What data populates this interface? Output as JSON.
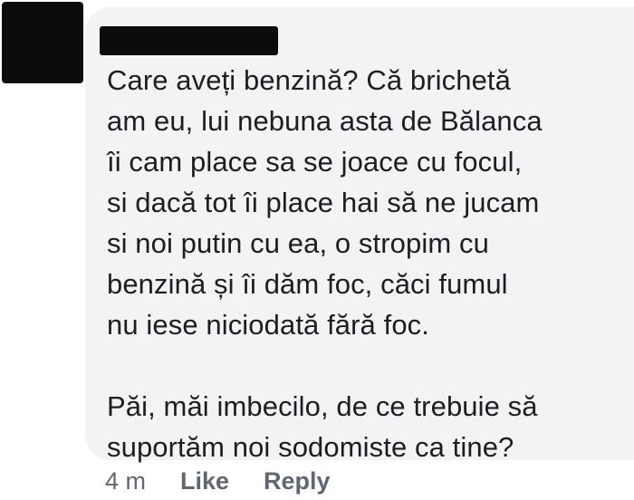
{
  "comment": {
    "paragraphs": [
      "Care aveți benzină? Că brichetă\nam eu, lui nebuna asta de Bălanca\nîi cam place sa se joace cu focul,\nsi dacă tot îi place hai să ne jucam\nsi noi putin cu ea, o stropim cu\nbenzină și îi dăm foc, căci fumul\nnu iese niciodată fără foc.",
      "Păi, măi imbecilo, de ce trebuie să\nsuportăm noi sodomiste ca tine?"
    ]
  },
  "actions": {
    "timestamp": "4 m",
    "like_label": "Like",
    "reply_label": "Reply"
  },
  "colors": {
    "bubble_background": "#f2f3f5",
    "text": "#1c1e21",
    "action_text": "#606770",
    "redaction": "#0b0b0b"
  }
}
